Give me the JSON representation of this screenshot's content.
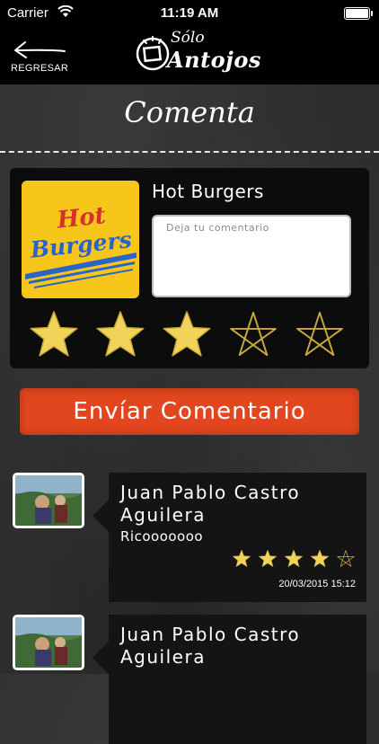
{
  "status_bar": {
    "carrier": "Carrier",
    "time": "11:19 AM"
  },
  "nav": {
    "back_label": "REGRESAR",
    "logo_line1": "Sólo",
    "logo_line2": "Antojos",
    "logo_icon": "box-with-rays-icon"
  },
  "page": {
    "title": "Comenta"
  },
  "compose": {
    "restaurant_name": "Hot Burgers",
    "restaurant_logo_text": {
      "line1": "Hot",
      "line2": "Burgers"
    },
    "comment_placeholder": "Deja tu comentario",
    "comment_value": "",
    "rating": 3,
    "max_rating": 5
  },
  "send_button_label": "Envíar Comentario",
  "comments": [
    {
      "author": "Juan Pablo Castro Aguilera",
      "text": "Ricooooooo",
      "rating": 4,
      "max_rating": 5,
      "date": "20/03/2015 15:12"
    },
    {
      "author": "Juan Pablo Castro Aguilera",
      "text": "",
      "rating": 0,
      "max_rating": 5,
      "date": ""
    }
  ],
  "colors": {
    "accent_orange": "#e2461e",
    "star_fill": "#f1d35a",
    "logo_yellow": "#f7c61b",
    "logo_red": "#d6312b",
    "logo_blue": "#2a64c9"
  }
}
